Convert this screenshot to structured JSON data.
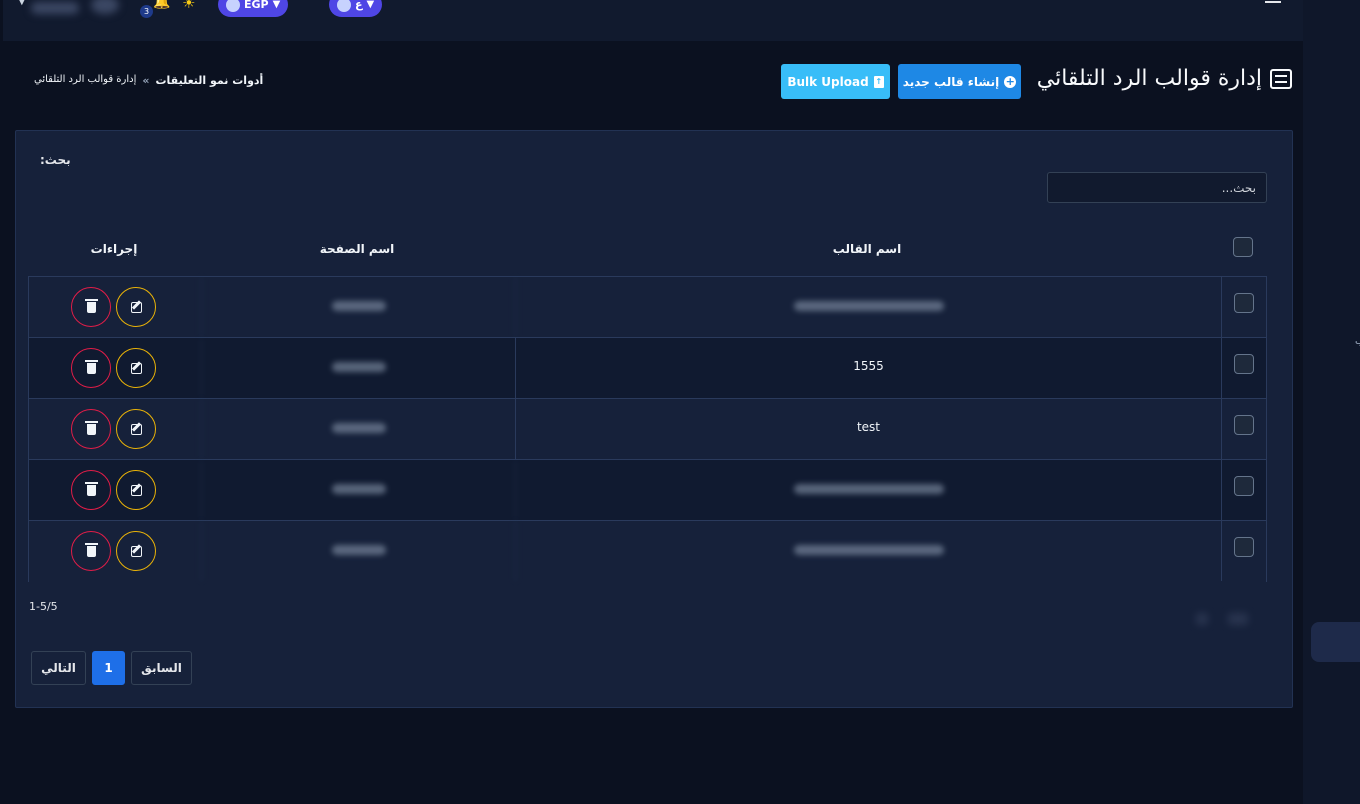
{
  "topbar": {
    "currency_label": "EGP",
    "language_label": "ع",
    "notification_count": "3"
  },
  "header": {
    "title": "إدارة قوالب الرد التلقائي",
    "create_button": "إنشاء قالب جديد",
    "bulk_upload_button": "Bulk Upload"
  },
  "breadcrumb": {
    "parent": "أدوات نمو التعليقات",
    "separator": "»",
    "current": "إدارة قوالب الرد التلقائي"
  },
  "search": {
    "label": "بحث:",
    "placeholder": "بحث..."
  },
  "table": {
    "headers": {
      "template_name": "اسم القالب",
      "page_name": "اسم الصفحة",
      "actions": "إجراءات"
    },
    "rows": [
      {
        "template_name": "",
        "page_name": "",
        "template_hidden": true
      },
      {
        "template_name": "1555",
        "page_name": "",
        "template_hidden": false
      },
      {
        "template_name": "test",
        "page_name": "",
        "template_hidden": false
      },
      {
        "template_name": "",
        "page_name": "",
        "template_hidden": true
      },
      {
        "template_name": "",
        "page_name": "",
        "template_hidden": true
      }
    ]
  },
  "pagination": {
    "count_text": "1-5/5",
    "next_label": "التالي",
    "current_page": "1",
    "prev_label": "السابق"
  },
  "colors": {
    "primary": "#1e88e5",
    "info": "#38bdf8",
    "danger": "#e11d48",
    "warning": "#eab308"
  }
}
